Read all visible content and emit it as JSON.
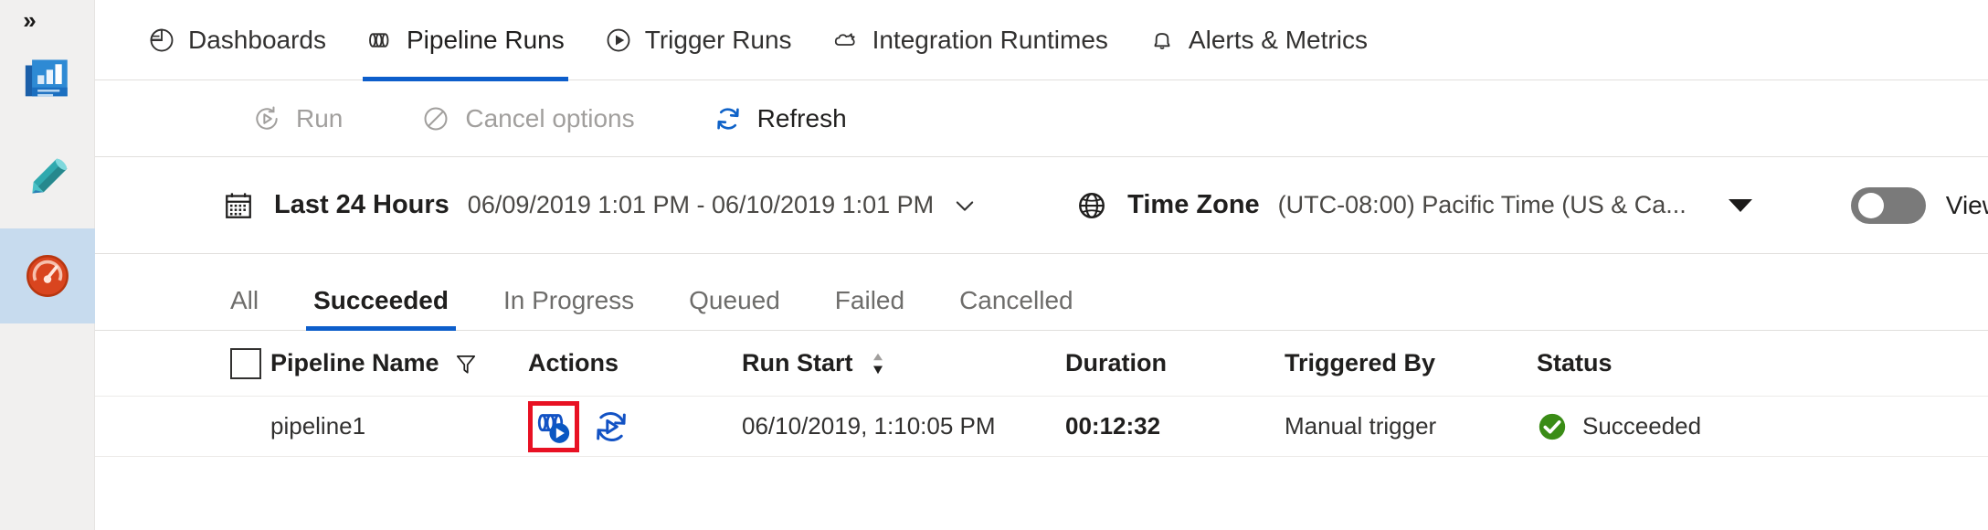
{
  "rail": {
    "collapse_label": "»",
    "items": [
      {
        "name": "overview-icon",
        "title": "Overview",
        "selected": false
      },
      {
        "name": "author-pencil-icon",
        "title": "Author",
        "selected": false
      },
      {
        "name": "monitor-gauge-icon",
        "title": "Monitor",
        "selected": true
      }
    ]
  },
  "tabs": [
    {
      "label": "Dashboards",
      "icon": "pie-chart-icon",
      "active": false
    },
    {
      "label": "Pipeline Runs",
      "icon": "pipeline-icon",
      "active": true
    },
    {
      "label": "Trigger Runs",
      "icon": "play-circle-icon",
      "active": false
    },
    {
      "label": "Integration Runtimes",
      "icon": "integration-runtime-icon",
      "active": false
    },
    {
      "label": "Alerts & Metrics",
      "icon": "bell-icon",
      "active": false
    }
  ],
  "commandbar": [
    {
      "label": "Run",
      "icon": "run-icon",
      "enabled": false
    },
    {
      "label": "Cancel options",
      "icon": "cancel-icon",
      "enabled": false
    },
    {
      "label": "Refresh",
      "icon": "refresh-icon",
      "enabled": true
    }
  ],
  "filterbar": {
    "date_icon": "calendar-icon",
    "date_label": "Last 24 Hours",
    "date_range": "06/09/2019 1:01 PM - 06/10/2019 1:01 PM",
    "timezone_icon": "globe-icon",
    "timezone_label": "Time Zone",
    "timezone_value": "(UTC-08:00) Pacific Time (US & Ca...",
    "toggle_label": "View All Rer",
    "toggle_on": false
  },
  "pivots": [
    {
      "label": "All",
      "active": false
    },
    {
      "label": "Succeeded",
      "active": true
    },
    {
      "label": "In Progress",
      "active": false
    },
    {
      "label": "Queued",
      "active": false
    },
    {
      "label": "Failed",
      "active": false
    },
    {
      "label": "Cancelled",
      "active": false
    }
  ],
  "table": {
    "headers": {
      "pipeline_name": "Pipeline Name",
      "actions": "Actions",
      "run_start": "Run Start",
      "duration": "Duration",
      "triggered_by": "Triggered By",
      "status": "Status"
    },
    "rows": [
      {
        "pipeline_name": "pipeline1",
        "run_start": "06/10/2019, 1:10:05 PM",
        "duration": "00:12:32",
        "triggered_by": "Manual trigger",
        "status": "Succeeded",
        "status_icon": "success-check-icon",
        "actions": [
          {
            "name": "view-activity-runs-icon",
            "highlighted": true
          },
          {
            "name": "rerun-icon",
            "highlighted": false
          }
        ]
      }
    ]
  },
  "colors": {
    "accent": "#0d5ecb",
    "highlight": "#e81123",
    "success": "#3a8c16",
    "rail_selected": "#c7dbee"
  }
}
